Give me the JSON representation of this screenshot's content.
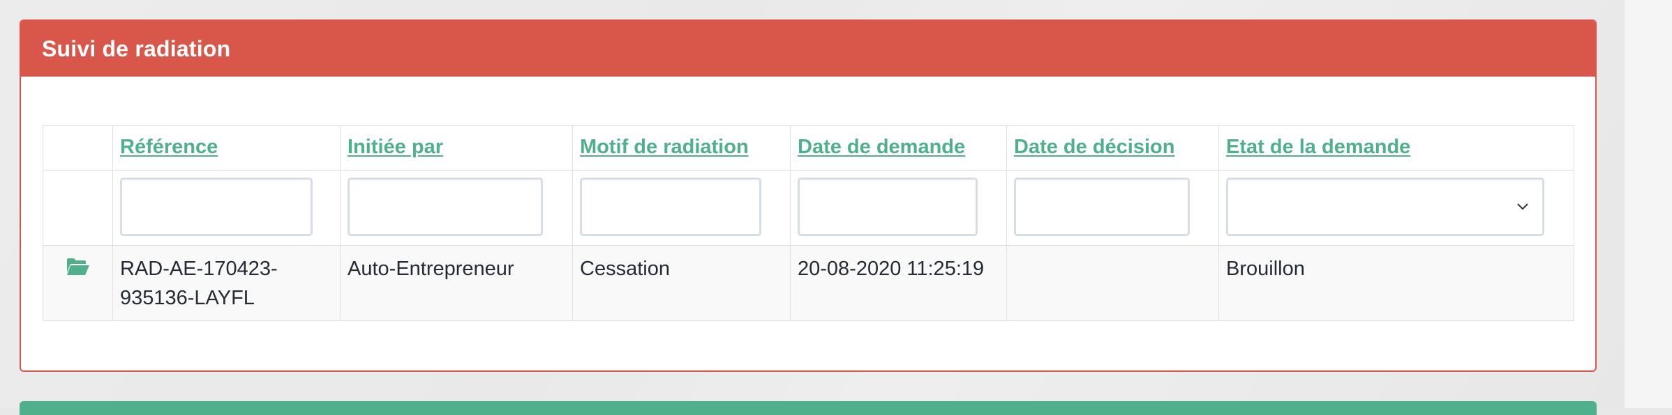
{
  "panel": {
    "title": "Suivi de radiation",
    "header_color": "#d9574a",
    "accent_color": "#4fb08b"
  },
  "table": {
    "columns": [
      {
        "label": ""
      },
      {
        "label": "Référence"
      },
      {
        "label": "Initiée par"
      },
      {
        "label": "Motif de radiation"
      },
      {
        "label": "Date de demande"
      },
      {
        "label": "Date de décision"
      },
      {
        "label": "Etat de la demande"
      }
    ],
    "filters": {
      "reference": "",
      "initiee_par": "",
      "motif": "",
      "date_demande": "",
      "date_decision": "",
      "etat_selected": ""
    },
    "rows": [
      {
        "icon": "folder-open-icon",
        "reference": "RAD-AE-170423-935136-LAYFL",
        "initiee_par": "Auto-Entrepreneur",
        "motif": "Cessation",
        "date_demande": "20-08-2020 11:25:19",
        "date_decision": "",
        "etat": "Brouillon"
      }
    ]
  }
}
